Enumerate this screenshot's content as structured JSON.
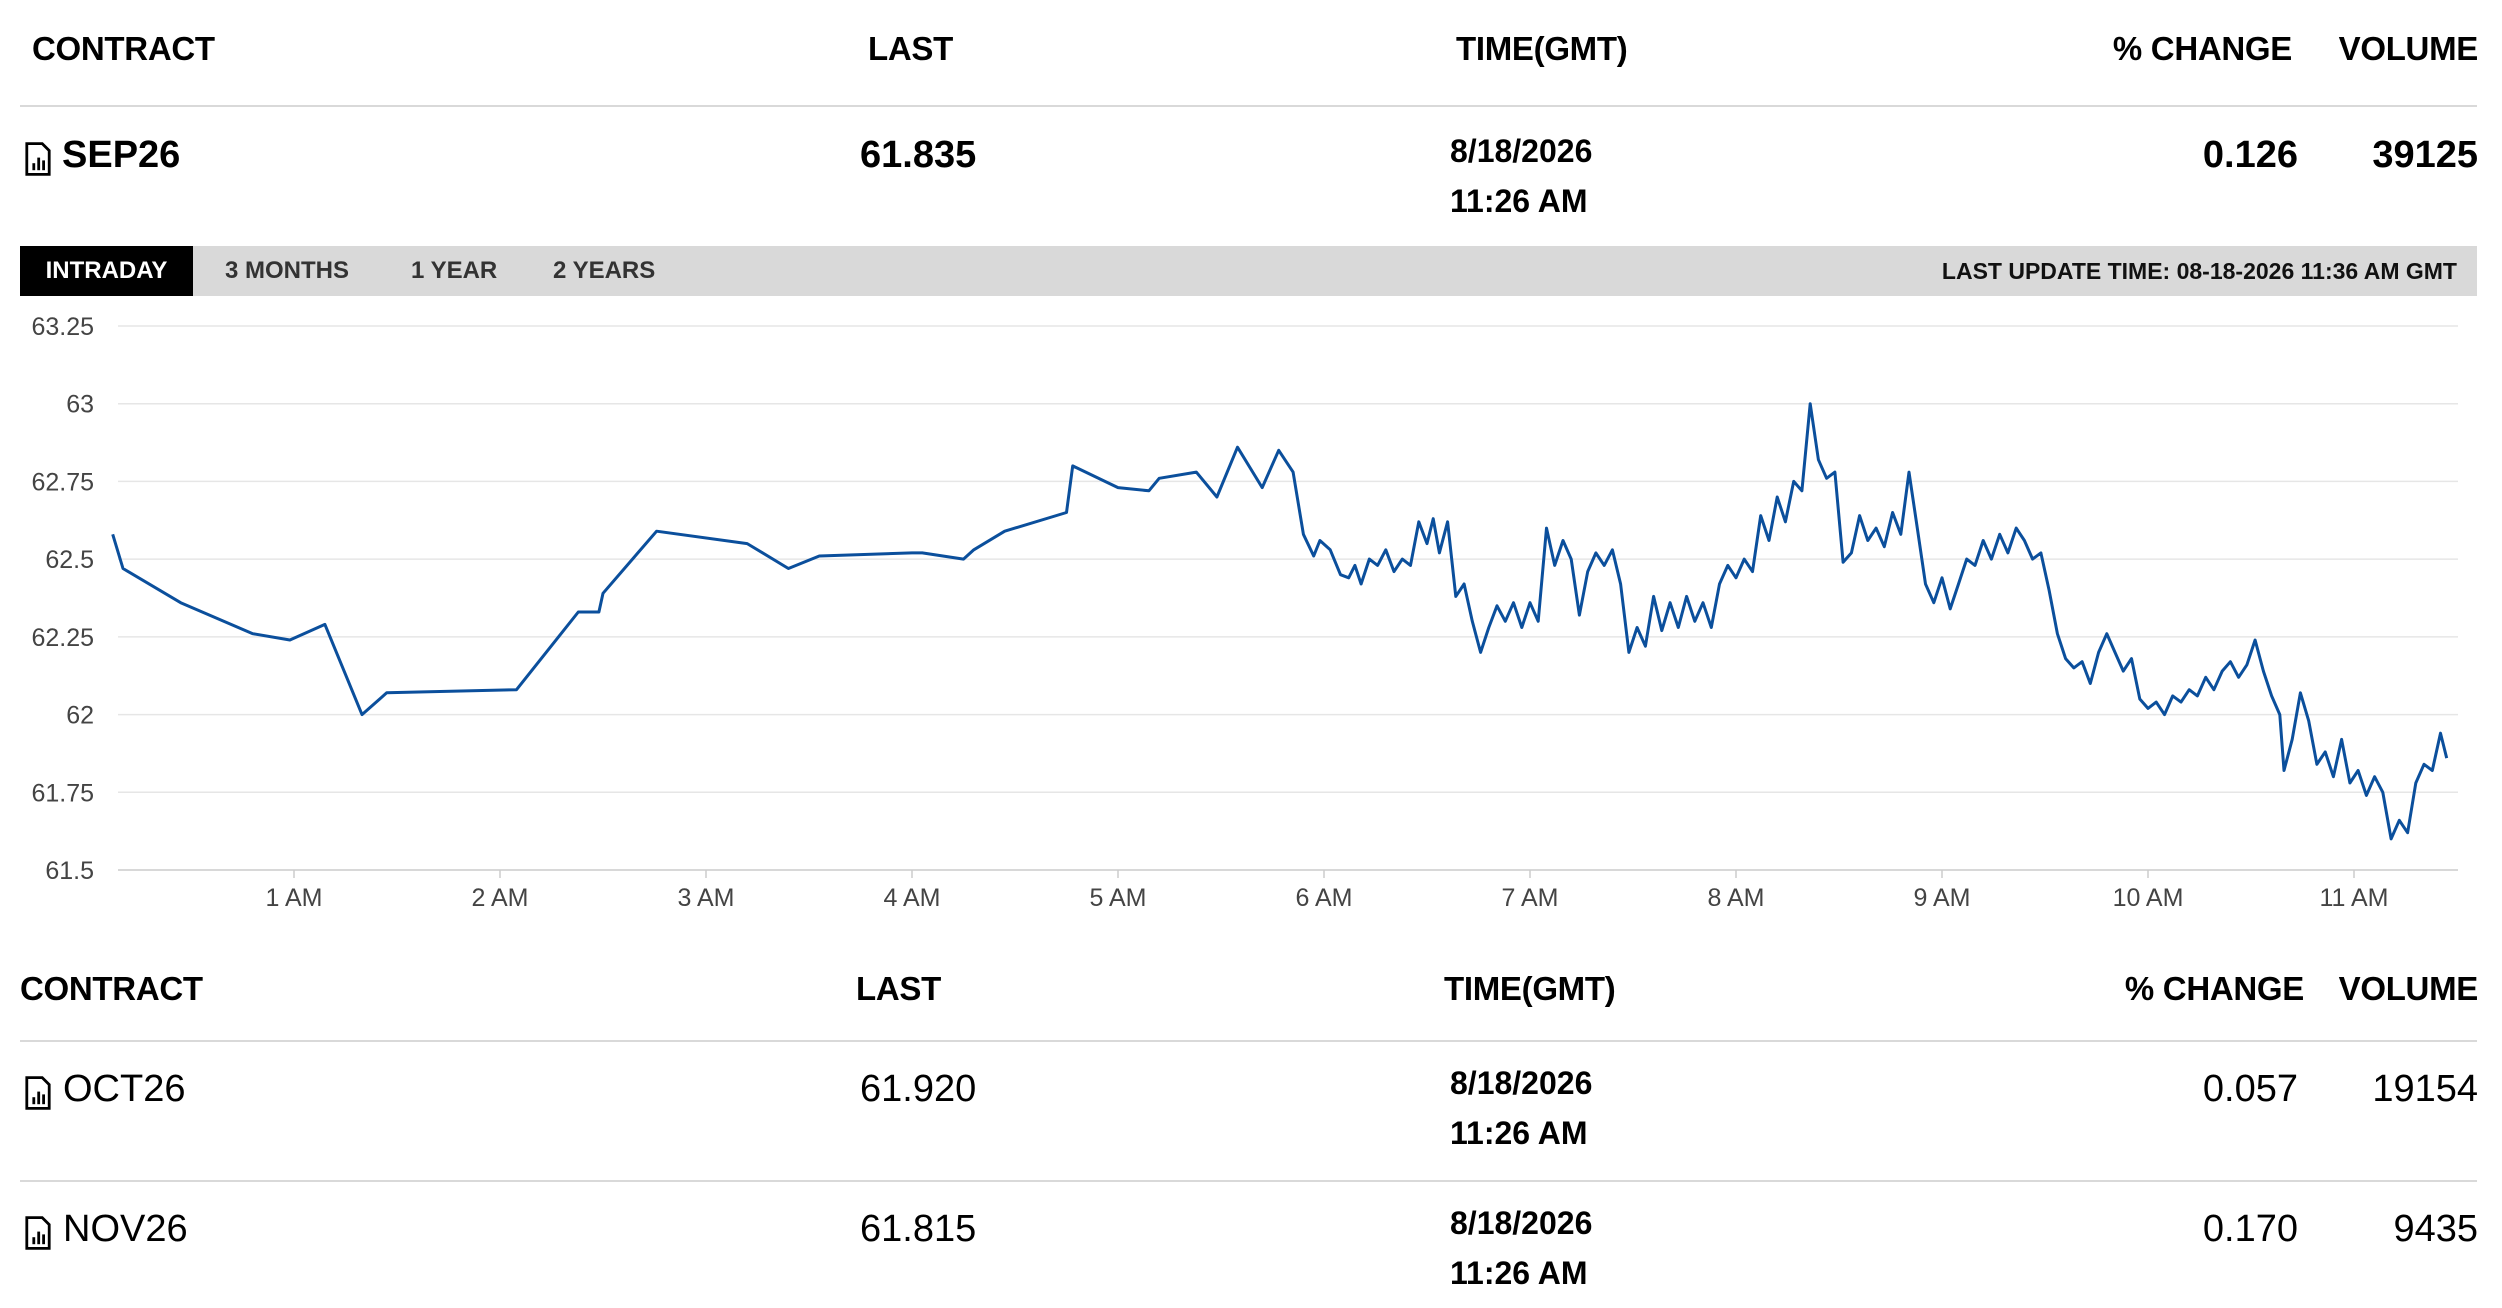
{
  "top_table": {
    "headers": {
      "contract": "CONTRACT",
      "last": "LAST",
      "time": "TIME(GMT)",
      "change": "% CHANGE",
      "volume": "VOLUME"
    },
    "row": {
      "icon": "document-chart-icon",
      "contract": "SEP26",
      "last": "61.835",
      "date": "8/18/2026",
      "time": "11:26 AM",
      "change": "0.126",
      "volume": "39125"
    }
  },
  "tabs": [
    "INTRADAY",
    "3 MONTHS",
    "1 YEAR",
    "2 YEARS"
  ],
  "active_tab": "INTRADAY",
  "last_update": "LAST UPDATE TIME: 08-18-2026 11:36 AM GMT",
  "colors": {
    "line": "#0b4f9c",
    "tab_bar": "#d9d9d9",
    "active_tab": "#000000",
    "grid": "#e6e6e6"
  },
  "chart_data": {
    "type": "line",
    "y_ticks": [
      "63.25",
      "63",
      "62.75",
      "62.5",
      "62.25",
      "62",
      "61.75",
      "61.5"
    ],
    "ylim": [
      61.5,
      63.25
    ],
    "x_ticks": [
      "1 AM",
      "2 AM",
      "3 AM",
      "4 AM",
      "5 AM",
      "6 AM",
      "7 AM",
      "8 AM",
      "9 AM",
      "10 AM",
      "11 AM"
    ],
    "xlim": [
      0.12,
      11.45
    ],
    "grid": true,
    "series": [
      {
        "points": [
          [
            0.12,
            62.58
          ],
          [
            0.17,
            62.47
          ],
          [
            0.45,
            62.36
          ],
          [
            0.8,
            62.26
          ],
          [
            0.98,
            62.24
          ],
          [
            1.15,
            62.29
          ],
          [
            1.33,
            62.0
          ],
          [
            1.45,
            62.07
          ],
          [
            2.08,
            62.08
          ],
          [
            2.38,
            62.33
          ],
          [
            2.48,
            62.33
          ],
          [
            2.5,
            62.39
          ],
          [
            2.76,
            62.59
          ],
          [
            3.2,
            62.55
          ],
          [
            3.4,
            62.47
          ],
          [
            3.55,
            62.51
          ],
          [
            4.0,
            62.52
          ],
          [
            4.05,
            62.52
          ],
          [
            4.25,
            62.5
          ],
          [
            4.3,
            62.53
          ],
          [
            4.45,
            62.59
          ],
          [
            4.75,
            62.65
          ],
          [
            4.78,
            62.8
          ],
          [
            5.0,
            62.73
          ],
          [
            5.15,
            62.72
          ],
          [
            5.2,
            62.76
          ],
          [
            5.38,
            62.78
          ],
          [
            5.48,
            62.7
          ],
          [
            5.58,
            62.86
          ],
          [
            5.7,
            62.73
          ],
          [
            5.78,
            62.85
          ],
          [
            5.85,
            62.78
          ],
          [
            5.9,
            62.58
          ],
          [
            5.95,
            62.51
          ],
          [
            5.98,
            62.56
          ],
          [
            6.03,
            62.53
          ],
          [
            6.08,
            62.45
          ],
          [
            6.12,
            62.44
          ],
          [
            6.15,
            62.48
          ],
          [
            6.18,
            62.42
          ],
          [
            6.22,
            62.5
          ],
          [
            6.26,
            62.48
          ],
          [
            6.3,
            62.53
          ],
          [
            6.34,
            62.46
          ],
          [
            6.38,
            62.5
          ],
          [
            6.42,
            62.48
          ],
          [
            6.46,
            62.62
          ],
          [
            6.5,
            62.55
          ],
          [
            6.53,
            62.63
          ],
          [
            6.56,
            62.52
          ],
          [
            6.6,
            62.62
          ],
          [
            6.64,
            62.38
          ],
          [
            6.68,
            62.42
          ],
          [
            6.72,
            62.3
          ],
          [
            6.76,
            62.2
          ],
          [
            6.8,
            62.28
          ],
          [
            6.84,
            62.35
          ],
          [
            6.88,
            62.3
          ],
          [
            6.92,
            62.36
          ],
          [
            6.96,
            62.28
          ],
          [
            7.0,
            62.36
          ],
          [
            7.04,
            62.3
          ],
          [
            7.08,
            62.6
          ],
          [
            7.12,
            62.48
          ],
          [
            7.16,
            62.56
          ],
          [
            7.2,
            62.5
          ],
          [
            7.24,
            62.32
          ],
          [
            7.28,
            62.46
          ],
          [
            7.32,
            62.52
          ],
          [
            7.36,
            62.48
          ],
          [
            7.4,
            62.53
          ],
          [
            7.44,
            62.42
          ],
          [
            7.48,
            62.2
          ],
          [
            7.52,
            62.28
          ],
          [
            7.56,
            62.22
          ],
          [
            7.6,
            62.38
          ],
          [
            7.64,
            62.27
          ],
          [
            7.68,
            62.36
          ],
          [
            7.72,
            62.28
          ],
          [
            7.76,
            62.38
          ],
          [
            7.8,
            62.3
          ],
          [
            7.84,
            62.36
          ],
          [
            7.88,
            62.28
          ],
          [
            7.92,
            62.42
          ],
          [
            7.96,
            62.48
          ],
          [
            8.0,
            62.44
          ],
          [
            8.04,
            62.5
          ],
          [
            8.08,
            62.46
          ],
          [
            8.12,
            62.64
          ],
          [
            8.16,
            62.56
          ],
          [
            8.2,
            62.7
          ],
          [
            8.24,
            62.62
          ],
          [
            8.28,
            62.75
          ],
          [
            8.32,
            62.72
          ],
          [
            8.36,
            63.0
          ],
          [
            8.4,
            62.82
          ],
          [
            8.44,
            62.76
          ],
          [
            8.48,
            62.78
          ],
          [
            8.52,
            62.49
          ],
          [
            8.56,
            62.52
          ],
          [
            8.6,
            62.64
          ],
          [
            8.64,
            62.56
          ],
          [
            8.68,
            62.6
          ],
          [
            8.72,
            62.54
          ],
          [
            8.76,
            62.65
          ],
          [
            8.8,
            62.58
          ],
          [
            8.84,
            62.78
          ],
          [
            8.88,
            62.6
          ],
          [
            8.92,
            62.42
          ],
          [
            8.96,
            62.36
          ],
          [
            9.0,
            62.44
          ],
          [
            9.04,
            62.34
          ],
          [
            9.08,
            62.42
          ],
          [
            9.12,
            62.5
          ],
          [
            9.16,
            62.48
          ],
          [
            9.2,
            62.56
          ],
          [
            9.24,
            62.5
          ],
          [
            9.28,
            62.58
          ],
          [
            9.32,
            62.52
          ],
          [
            9.36,
            62.6
          ],
          [
            9.4,
            62.56
          ],
          [
            9.44,
            62.5
          ],
          [
            9.48,
            62.52
          ],
          [
            9.52,
            62.4
          ],
          [
            9.56,
            62.26
          ],
          [
            9.6,
            62.18
          ],
          [
            9.64,
            62.15
          ],
          [
            9.68,
            62.17
          ],
          [
            9.72,
            62.1
          ],
          [
            9.76,
            62.2
          ],
          [
            9.8,
            62.26
          ],
          [
            9.84,
            62.2
          ],
          [
            9.88,
            62.14
          ],
          [
            9.92,
            62.18
          ],
          [
            9.96,
            62.05
          ],
          [
            10.0,
            62.02
          ],
          [
            10.04,
            62.04
          ],
          [
            10.08,
            62.0
          ],
          [
            10.12,
            62.06
          ],
          [
            10.16,
            62.04
          ],
          [
            10.2,
            62.08
          ],
          [
            10.24,
            62.06
          ],
          [
            10.28,
            62.12
          ],
          [
            10.32,
            62.08
          ],
          [
            10.36,
            62.14
          ],
          [
            10.4,
            62.17
          ],
          [
            10.44,
            62.12
          ],
          [
            10.48,
            62.16
          ],
          [
            10.52,
            62.24
          ],
          [
            10.56,
            62.14
          ],
          [
            10.6,
            62.06
          ],
          [
            10.64,
            62.0
          ],
          [
            10.66,
            61.82
          ],
          [
            10.7,
            61.92
          ],
          [
            10.74,
            62.07
          ],
          [
            10.78,
            61.98
          ],
          [
            10.82,
            61.84
          ],
          [
            10.86,
            61.88
          ],
          [
            10.9,
            61.8
          ],
          [
            10.94,
            61.92
          ],
          [
            10.98,
            61.78
          ],
          [
            11.02,
            61.82
          ],
          [
            11.06,
            61.74
          ],
          [
            11.1,
            61.8
          ],
          [
            11.14,
            61.75
          ],
          [
            11.18,
            61.6
          ],
          [
            11.22,
            61.66
          ],
          [
            11.26,
            61.62
          ],
          [
            11.3,
            61.78
          ],
          [
            11.34,
            61.84
          ],
          [
            11.38,
            61.82
          ],
          [
            11.42,
            61.94
          ],
          [
            11.45,
            61.86
          ]
        ]
      }
    ]
  },
  "bottom_table": {
    "headers": {
      "contract": "CONTRACT",
      "last": "LAST",
      "time": "TIME(GMT)",
      "change": "% CHANGE",
      "volume": "VOLUME"
    },
    "rows": [
      {
        "icon": "document-chart-icon",
        "contract": "OCT26",
        "last": "61.920",
        "date": "8/18/2026",
        "time": "11:26 AM",
        "change": "0.057",
        "volume": "19154"
      },
      {
        "icon": "document-chart-icon",
        "contract": "NOV26",
        "last": "61.815",
        "date": "8/18/2026",
        "time": "11:26 AM",
        "change": "0.170",
        "volume": "9435"
      }
    ]
  }
}
